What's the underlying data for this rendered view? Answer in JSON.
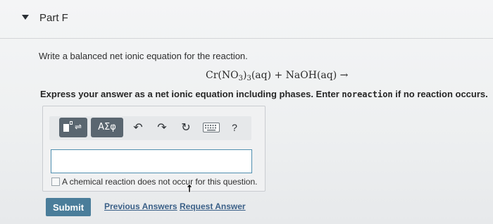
{
  "part": {
    "title": "Part F"
  },
  "question": {
    "prompt": "Write a balanced net ionic equation for the reaction.",
    "reaction": {
      "cr": "Cr(NO",
      "sub1": "3",
      "close": ")",
      "sub2": "3",
      "rest": "(aq) + NaOH(aq) →"
    },
    "instruction_before": "Express your answer as a net ionic equation including phases. Enter ",
    "instruction_code": "noreaction",
    "instruction_after": " if no reaction occurs."
  },
  "toolbar": {
    "greek_label": "ΑΣφ",
    "template_arrows": "⇌",
    "undo_glyph": "↶",
    "redo_glyph": "↷",
    "reset_glyph": "↻",
    "help_label": "?"
  },
  "answer": {
    "value": ""
  },
  "no_reaction": {
    "label": "A chemical reaction does not occur for this question.",
    "checked": false
  },
  "actions": {
    "submit_label": "Submit",
    "previous_answers_label": "Previous Answers",
    "request_answer_label": "Request Answer"
  },
  "colors": {
    "submit_bg": "#4a7d9a",
    "link": "#3a5f87",
    "toolbar_button": "#5a6670",
    "input_border": "#4f8fb0"
  },
  "icons": {
    "collapse": "caret-down-icon",
    "template": "template-icon",
    "undo": "undo-icon",
    "redo": "redo-icon",
    "reset": "reset-icon",
    "keyboard": "keyboard-icon",
    "help": "help-icon"
  }
}
